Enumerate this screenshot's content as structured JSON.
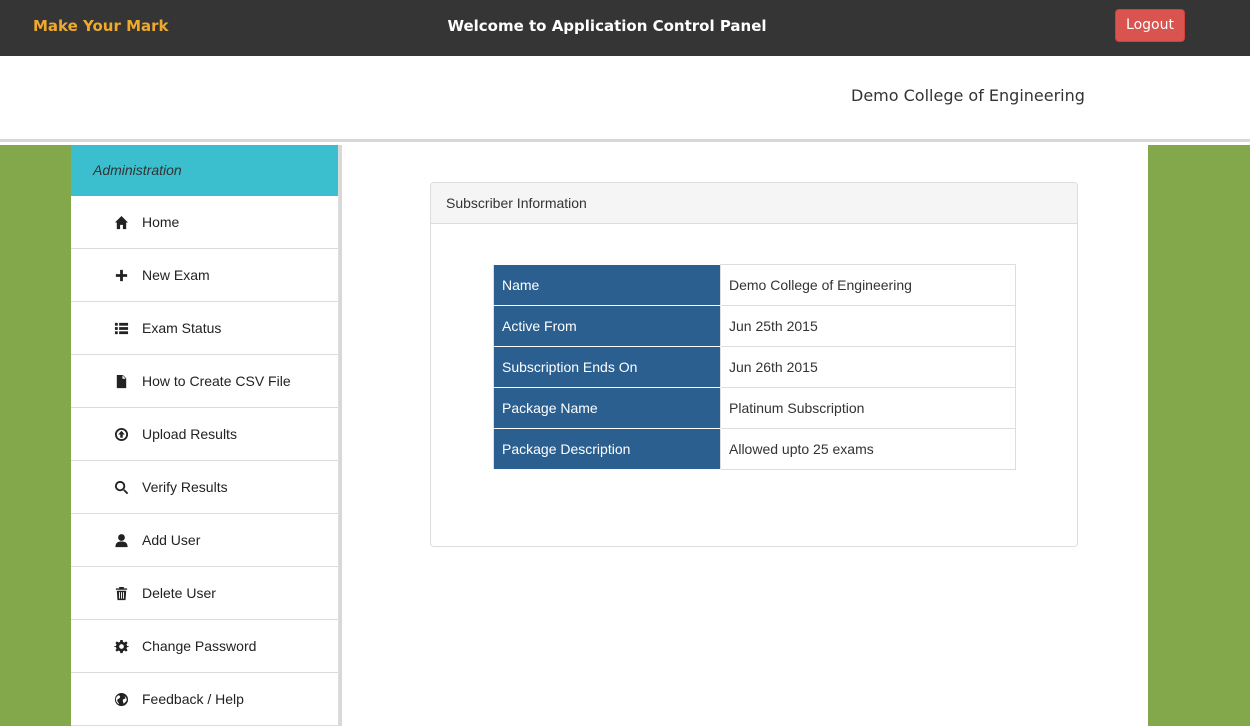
{
  "header": {
    "brand": "Make Your Mark",
    "welcome": "Welcome to Application Control Panel",
    "logout_label": "Logout"
  },
  "subheader": {
    "college_name": "Demo College of Engineering"
  },
  "sidebar": {
    "heading": "Administration",
    "items": [
      {
        "label": "Home",
        "icon": "home-icon"
      },
      {
        "label": "New Exam",
        "icon": "plus-icon"
      },
      {
        "label": "Exam Status",
        "icon": "list-icon"
      },
      {
        "label": "How to Create CSV File",
        "icon": "file-icon"
      },
      {
        "label": "Upload Results",
        "icon": "upload-icon"
      },
      {
        "label": "Verify Results",
        "icon": "search-icon"
      },
      {
        "label": "Add User",
        "icon": "user-icon"
      },
      {
        "label": "Delete User",
        "icon": "trash-icon"
      },
      {
        "label": "Change Password",
        "icon": "gear-icon"
      },
      {
        "label": "Feedback / Help",
        "icon": "globe-icon"
      }
    ]
  },
  "panel": {
    "title": "Subscriber Information",
    "rows": [
      {
        "key": "Name",
        "value": "Demo College of Engineering"
      },
      {
        "key": "Active From",
        "value": "Jun 25th 2015"
      },
      {
        "key": "Subscription Ends On",
        "value": "Jun 26th 2015"
      },
      {
        "key": "Package Name",
        "value": "Platinum Subscription"
      },
      {
        "key": "Package Description",
        "value": "Allowed upto 25 exams"
      }
    ]
  },
  "colors": {
    "topbar": "#353535",
    "brand": "#f0a92a",
    "logout": "#d9534f",
    "sidebar_heading": "#3bbfce",
    "background_green": "#83a84b",
    "table_key_bg": "#2a5f90"
  }
}
